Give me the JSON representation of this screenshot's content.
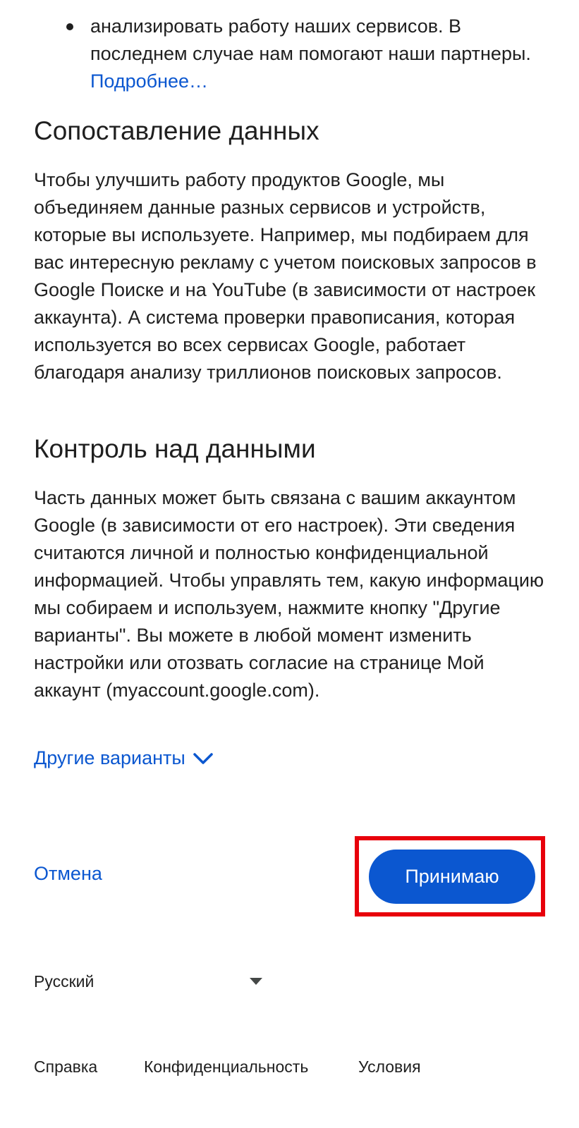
{
  "intro_bullet": {
    "text": "анализировать работу наших сервисов. В последнем случае нам помогают наши партнеры.",
    "link": "Подробнее…"
  },
  "section_combining": {
    "title": "Сопоставление данных",
    "text": "Чтобы улучшить работу продуктов Google, мы объединяем данные разных сервисов и устройств, которые вы используете. Например, мы подбираем для вас интересную рекламу с учетом поисковых запросов в Google Поиске и на YouTube (в зависимости от настроек аккаунта). А система проверки правописания, которая используется во всех сервисах Google, работает благодаря анализу триллионов поисковых запросов."
  },
  "section_control": {
    "title": "Контроль над данными",
    "text": "Часть данных может быть связана с вашим аккаунтом Google (в зависимости от его настроек). Эти сведения считаются личной и полностью конфиденциальной информацией. Чтобы управлять тем, какую информацию мы собираем и используем, нажмите кнопку \"Другие варианты\". Вы можете в любой момент изменить настройки или отозвать согласие на странице Мой аккаунт (myaccount.google.com)."
  },
  "more_options": {
    "label": "Другие варианты",
    "icon": "chevron-down-icon"
  },
  "actions": {
    "cancel_label": "Отмена",
    "accept_label": "Принимаю",
    "highlight_color": "#e8000b",
    "accent_color": "#0b57d0"
  },
  "language": {
    "selected": "Русский",
    "icon": "dropdown-triangle-icon"
  },
  "footer": {
    "help": "Справка",
    "privacy": "Конфиденциальность",
    "terms": "Условия"
  }
}
